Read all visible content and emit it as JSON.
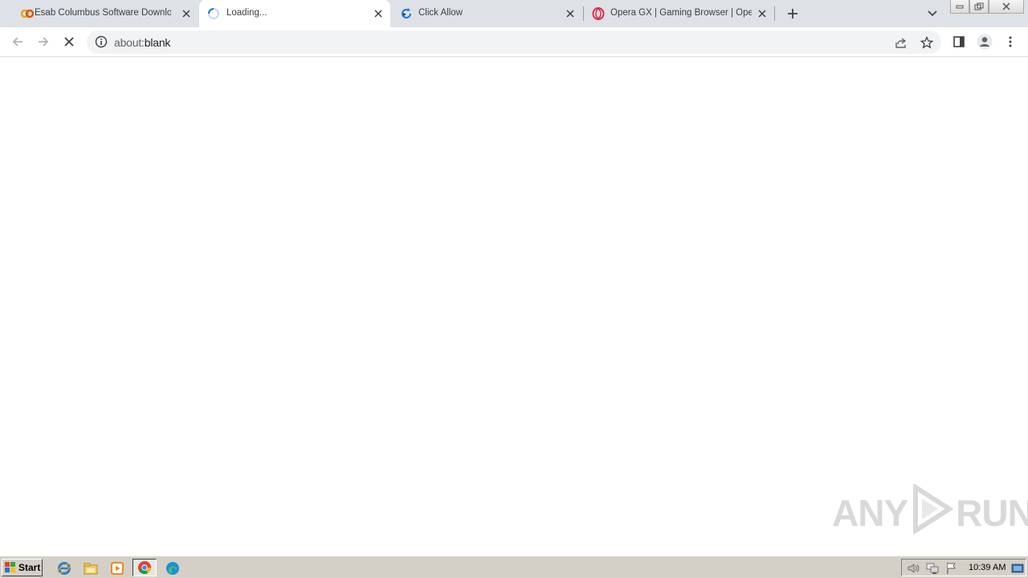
{
  "tabs": [
    {
      "title": "Esab Columbus Software Download F",
      "favicon": "esab-favicon-icon",
      "active": false
    },
    {
      "title": "Loading...",
      "favicon": "loading-spinner-icon",
      "active": true
    },
    {
      "title": "Click Allow",
      "favicon": "refresh-favicon-icon",
      "active": false
    },
    {
      "title": "Opera GX | Gaming Browser | Opera",
      "favicon": "opera-favicon-icon",
      "active": false
    }
  ],
  "toolbar": {
    "url_scheme": "about:",
    "url_rest": "blank"
  },
  "watermark": {
    "left": "ANY",
    "right": "RUN"
  },
  "taskbar": {
    "start_label": "Start",
    "pinned": [
      "internet-explorer-icon",
      "file-explorer-icon",
      "media-player-icon",
      "chrome-icon",
      "edge-icon"
    ],
    "clock": "10:39 AM"
  },
  "colors": {
    "tabstrip": "#dee1e6",
    "omnibox": "#f1f3f4",
    "taskbar": "#d4d0c8",
    "accent_blue": "#1a73e8"
  }
}
